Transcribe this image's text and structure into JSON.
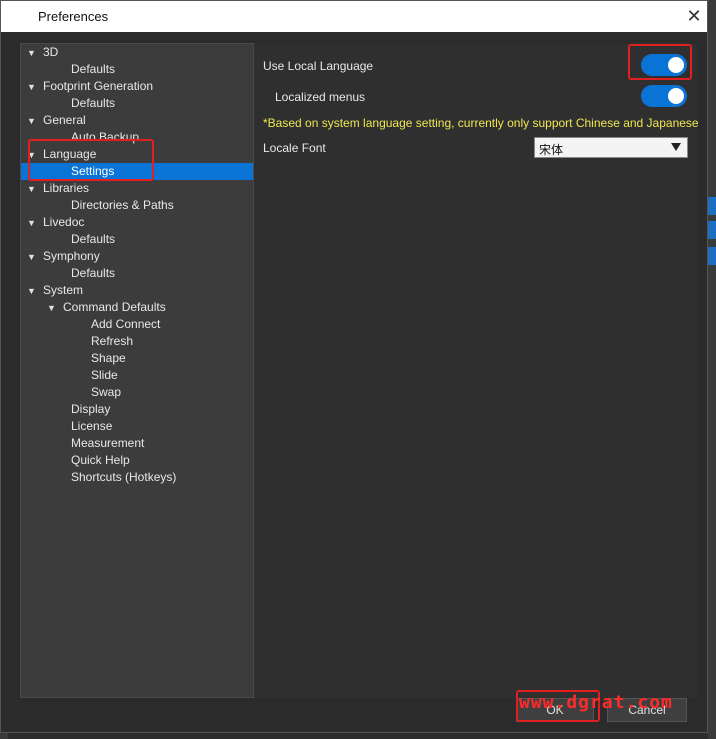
{
  "window": {
    "title": "Preferences",
    "close_glyph": "✕"
  },
  "tree": {
    "items": [
      {
        "label": "3D",
        "arrow": "▼"
      },
      {
        "label": "Defaults",
        "arrow": ""
      },
      {
        "label": "Footprint Generation",
        "arrow": "▼"
      },
      {
        "label": "Defaults",
        "arrow": ""
      },
      {
        "label": "General",
        "arrow": "▼"
      },
      {
        "label": "Auto Backup",
        "arrow": ""
      },
      {
        "label": "Language",
        "arrow": "▼"
      },
      {
        "label": "Settings",
        "arrow": ""
      },
      {
        "label": "Libraries",
        "arrow": "▼"
      },
      {
        "label": "Directories & Paths",
        "arrow": ""
      },
      {
        "label": "Livedoc",
        "arrow": "▼"
      },
      {
        "label": "Defaults",
        "arrow": ""
      },
      {
        "label": "Symphony",
        "arrow": "▼"
      },
      {
        "label": "Defaults",
        "arrow": ""
      },
      {
        "label": "System",
        "arrow": "▼"
      },
      {
        "label": "Command Defaults",
        "arrow": "▼"
      },
      {
        "label": "Add Connect",
        "arrow": ""
      },
      {
        "label": "Refresh",
        "arrow": ""
      },
      {
        "label": "Shape",
        "arrow": ""
      },
      {
        "label": "Slide",
        "arrow": ""
      },
      {
        "label": "Swap",
        "arrow": ""
      },
      {
        "label": "Display",
        "arrow": ""
      },
      {
        "label": "License",
        "arrow": ""
      },
      {
        "label": "Measurement",
        "arrow": ""
      },
      {
        "label": "Quick Help",
        "arrow": ""
      },
      {
        "label": "Shortcuts (Hotkeys)",
        "arrow": ""
      }
    ],
    "selected": "Settings"
  },
  "settings": {
    "use_local_language_label": "Use Local Language",
    "use_local_language_on": true,
    "localized_menus_label": "Localized menus",
    "localized_menus_on": true,
    "note": "*Based on system language setting, currently only support Chinese and Japanese",
    "locale_font_label": "Locale Font",
    "locale_font_value": "宋体"
  },
  "buttons": {
    "ok": "OK",
    "cancel": "Cancel"
  },
  "watermark": "www.dgrat.com",
  "colors": {
    "accent": "#0a74d6",
    "note": "#f0e650",
    "highlight": "#e02020"
  }
}
